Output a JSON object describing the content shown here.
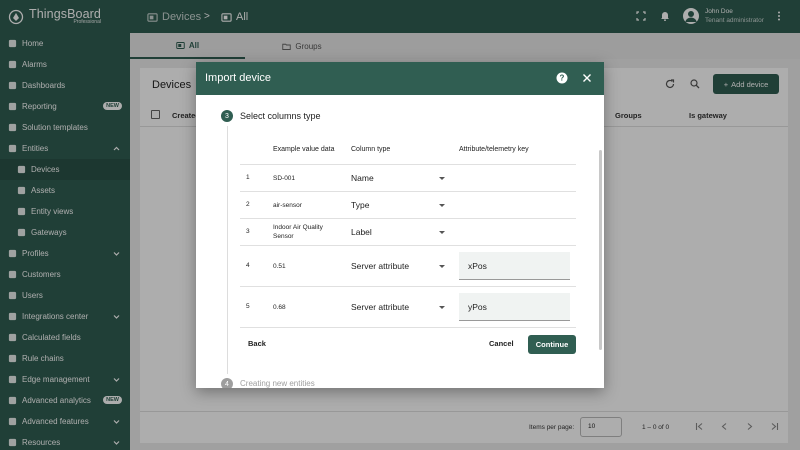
{
  "brand": {
    "name": "ThingsBoard",
    "edition": "Professional"
  },
  "sidebar": {
    "items": [
      {
        "label": "Home",
        "icon": "home-icon"
      },
      {
        "label": "Alarms",
        "icon": "alarm-icon"
      },
      {
        "label": "Dashboards",
        "icon": "dashboard-icon"
      },
      {
        "label": "Reporting",
        "icon": "report-icon",
        "badge": "NEW"
      },
      {
        "label": "Solution templates",
        "icon": "template-icon"
      },
      {
        "label": "Entities",
        "icon": "entities-icon",
        "expanded": true
      },
      {
        "label": "Devices",
        "icon": "device-icon",
        "active": true
      },
      {
        "label": "Assets",
        "icon": "asset-icon"
      },
      {
        "label": "Entity views",
        "icon": "entity-view-icon"
      },
      {
        "label": "Gateways",
        "icon": "gateway-icon"
      },
      {
        "label": "Profiles",
        "icon": "profile-icon"
      },
      {
        "label": "Customers",
        "icon": "customers-icon"
      },
      {
        "label": "Users",
        "icon": "users-icon"
      },
      {
        "label": "Integrations center",
        "icon": "integrations-icon"
      },
      {
        "label": "Calculated fields",
        "icon": "calculated-fields-icon"
      },
      {
        "label": "Rule chains",
        "icon": "rule-chain-icon"
      },
      {
        "label": "Edge management",
        "icon": "edge-icon"
      },
      {
        "label": "Advanced analytics",
        "icon": "analytics-icon",
        "badge": "NEW"
      },
      {
        "label": "Advanced features",
        "icon": "features-icon"
      },
      {
        "label": "Resources",
        "icon": "resources-icon"
      }
    ]
  },
  "topbar": {
    "crumbs": [
      "Devices",
      ">",
      "All"
    ],
    "user_name": "John Doe",
    "user_role": "Tenant administrator"
  },
  "tabs": {
    "all": "All",
    "groups": "Groups"
  },
  "card": {
    "title": "Devices",
    "add_label": "Add device",
    "columns": {
      "created": "Created",
      "groups": "Groups",
      "is_gateway": "Is gateway"
    },
    "items_per_page_label": "Items per page:",
    "items_per_page": "10",
    "range": "1 – 0 of 0"
  },
  "dialog": {
    "title": "Import device",
    "step3": {
      "num": "3",
      "label": "Select columns type"
    },
    "step4": {
      "num": "4",
      "label": "Creating new entities"
    },
    "headers": {
      "example": "Example value data",
      "type": "Column type",
      "key": "Attribute/telemetry key"
    },
    "rows": [
      {
        "n": "1",
        "value": "SD-001",
        "type": "Name",
        "key": ""
      },
      {
        "n": "2",
        "value": "air-sensor",
        "type": "Type",
        "key": ""
      },
      {
        "n": "3",
        "value": "Indoor Air Quality Sensor",
        "type": "Label",
        "key": ""
      },
      {
        "n": "4",
        "value": "0.51",
        "type": "Server attribute",
        "key": "xPos"
      },
      {
        "n": "5",
        "value": "0.68",
        "type": "Server attribute",
        "key": "yPos"
      }
    ],
    "back_label": "Back",
    "cancel_label": "Cancel",
    "continue_label": "Continue"
  },
  "colors": {
    "primary": "#305e52",
    "primary_dark": "#2a5247"
  }
}
